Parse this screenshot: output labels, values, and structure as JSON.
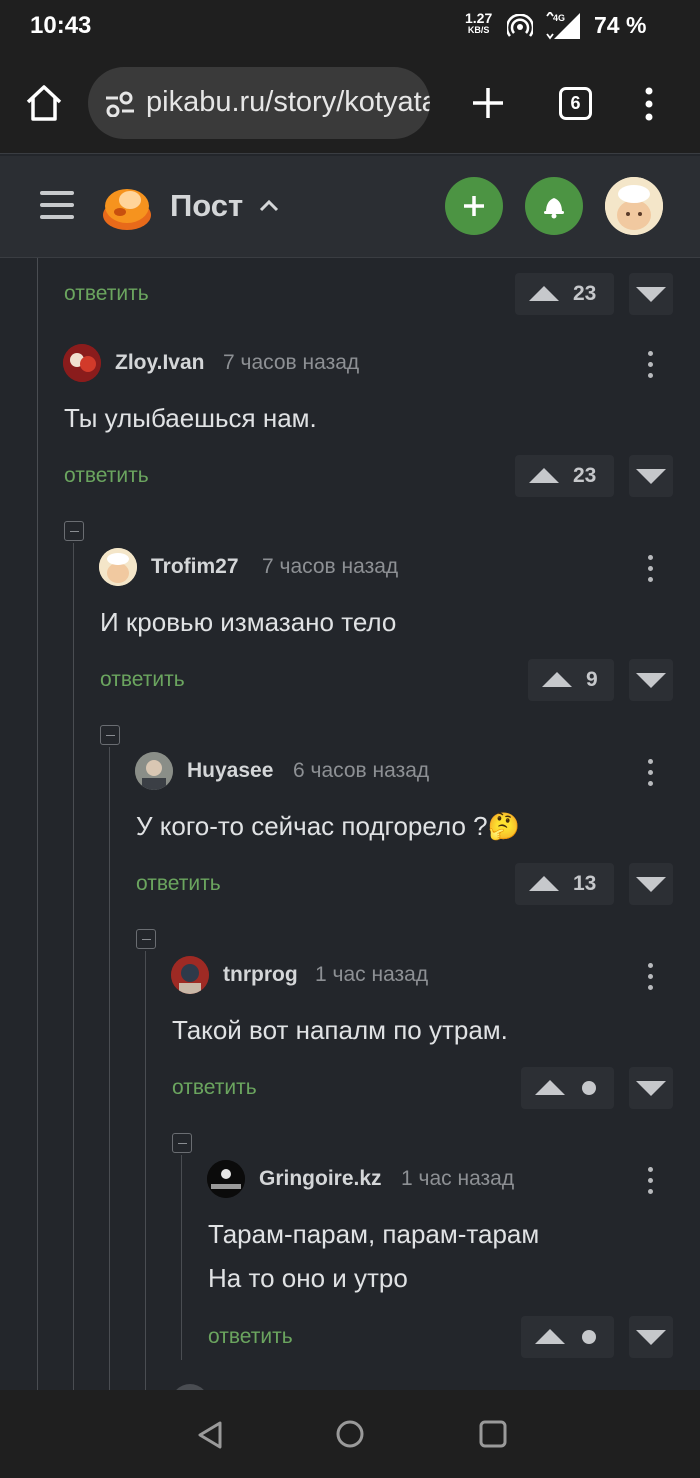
{
  "status": {
    "time": "10:43",
    "speed": "1.27",
    "speed_unit": "KB/S",
    "network": "4G",
    "battery": "74 %"
  },
  "browser": {
    "url": "pikabu.ru/story/kotyata",
    "tabs_count": "6"
  },
  "header": {
    "title": "Пост"
  },
  "comments": [
    {
      "reply": "ответить",
      "votes": "23"
    },
    {
      "user": "Zloy.Ivan",
      "time": "7 часов назад",
      "text": "Ты улыбаешься нам.",
      "reply": "ответить",
      "votes": "23"
    },
    {
      "user": "Trofim27",
      "time": "7 часов назад",
      "text": "И кровью измазано тело",
      "reply": "ответить",
      "votes": "9"
    },
    {
      "user": "Huyasee",
      "time": "6 часов назад",
      "text": "У кого-то сейчас подгорело ?🤔",
      "reply": "ответить",
      "votes": "13"
    },
    {
      "user": "tnrprog",
      "time": "1 час назад",
      "text": "Такой вот напалм по утрам.",
      "reply": "ответить"
    },
    {
      "user": "Gringoire.kz",
      "time": "1 час назад",
      "text_line1": "Тарам-парам, парам-тарам",
      "text_line2": "На то оно и утро",
      "reply": "ответить"
    }
  ],
  "colors": {
    "accent": "#4c9443",
    "reply": "#6ba55f",
    "background": "#23262b"
  }
}
